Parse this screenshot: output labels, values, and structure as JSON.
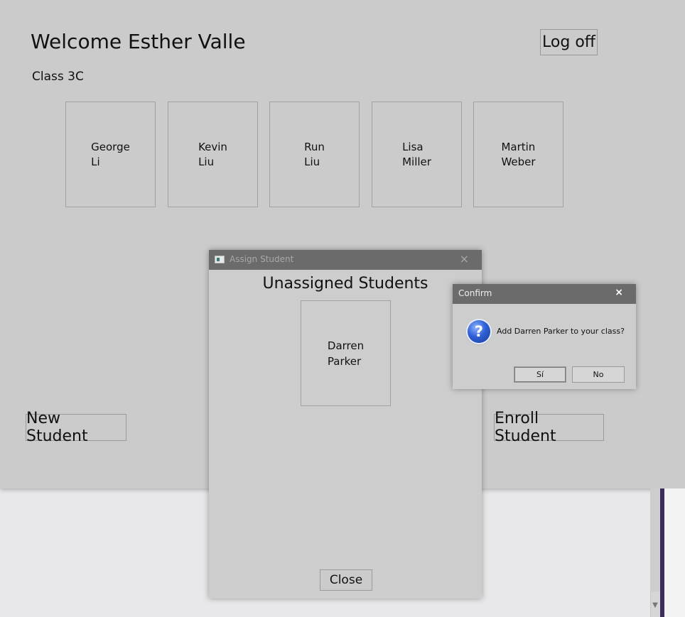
{
  "main": {
    "welcome": "Welcome Esther Valle",
    "class_label": "Class 3C",
    "logoff_label": "Log off",
    "new_student_label": "New Student",
    "enroll_student_label": "Enroll Student",
    "students": [
      {
        "first": "George",
        "last": "Li"
      },
      {
        "first": "Kevin",
        "last": "Liu"
      },
      {
        "first": "Run",
        "last": "Liu"
      },
      {
        "first": "Lisa",
        "last": "Miller"
      },
      {
        "first": "Martin",
        "last": "Weber"
      }
    ]
  },
  "assign_dialog": {
    "title": "Assign Student",
    "close_glyph": "×",
    "heading": "Unassigned Students",
    "students": [
      {
        "first": "Darren",
        "last": "Parker"
      }
    ],
    "close_label": "Close"
  },
  "confirm_dialog": {
    "title": "Confirm",
    "close_glyph": "×",
    "icon": "question-icon",
    "icon_glyph": "?",
    "message": "Add Darren Parker to your class?",
    "yes_label": "Sí",
    "no_label": "No"
  },
  "scrollbar": {
    "down_arrow_glyph": "▼"
  }
}
